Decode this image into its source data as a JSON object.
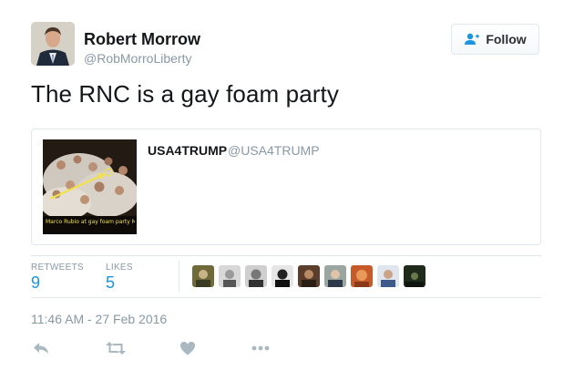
{
  "author": {
    "name": "Robert Morrow",
    "handle": "@RobMorroLiberty"
  },
  "follow_button": {
    "label": "Follow"
  },
  "tweet": {
    "text": "The RNC is a gay foam party",
    "timestamp": "11:46 AM - 27 Feb 2016"
  },
  "quoted_tweet": {
    "name": "USA4TRUMP",
    "handle": "@USA4TRUMP",
    "media_caption": "Marco Rubio at gay foam party Miami, Fl"
  },
  "stats": {
    "retweets_label": "RETWEETS",
    "retweets_value": "9",
    "likes_label": "LIKES",
    "likes_value": "5"
  },
  "likers_count": 10,
  "actions": [
    "reply-icon",
    "retweet-icon",
    "heart-icon",
    "more-icon"
  ],
  "colors": {
    "link_blue": "#1b95e0",
    "muted_gray": "#8899a6",
    "border": "#e1e8ed"
  }
}
